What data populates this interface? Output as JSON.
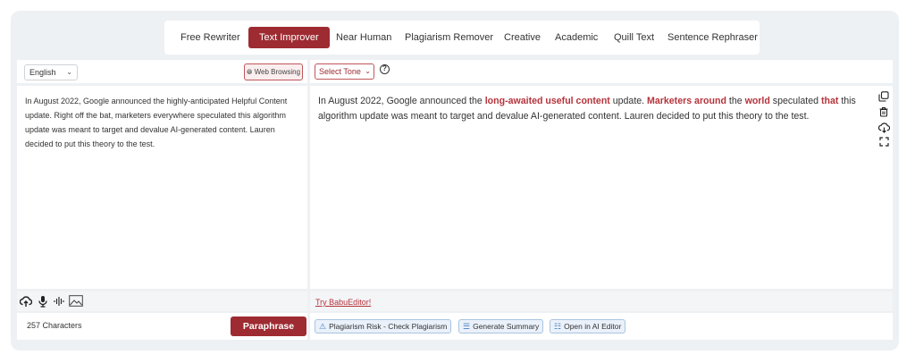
{
  "tabs": [
    {
      "label": "Free Rewriter",
      "active": false
    },
    {
      "label": "Text Improver",
      "active": true
    },
    {
      "label": "Near Human",
      "active": false
    },
    {
      "label": "Plagiarism Remover",
      "active": false
    },
    {
      "label": "Creative",
      "active": false
    },
    {
      "label": "Academic",
      "active": false
    },
    {
      "label": "Quill Text",
      "active": false
    },
    {
      "label": "Sentence Rephraser",
      "active": false
    }
  ],
  "input_panel": {
    "language": "English",
    "web_browsing_label": "Web Browsing",
    "text": "In August 2022, Google announced the highly-anticipated Helpful Content update. Right off the bat, marketers everywhere speculated this algorithm update was meant to target and devalue AI-generated content. Lauren decided to put this theory to the test.",
    "tools": [
      {
        "icon": "cloud-upload-icon"
      },
      {
        "icon": "microphone-icon"
      },
      {
        "icon": "audio-wave-icon"
      },
      {
        "icon": "image-icon"
      }
    ],
    "char_count": "257 Characters",
    "paraphrase_label": "Paraphrase"
  },
  "output_panel": {
    "tone_placeholder": "Select Tone",
    "segments": [
      {
        "text": "In August 2022, Google announced the ",
        "highlight": false
      },
      {
        "text": "long-awaited useful content",
        "highlight": true
      },
      {
        "text": " update. ",
        "highlight": false
      },
      {
        "text": "Marketers around",
        "highlight": true
      },
      {
        "text": " the ",
        "highlight": false
      },
      {
        "text": "world",
        "highlight": true
      },
      {
        "text": " speculated ",
        "highlight": false
      },
      {
        "text": "that",
        "highlight": true
      },
      {
        "text": " this algorithm update was meant to target and devalue AI-generated content. Lauren decided to put this theory to the test.",
        "highlight": false
      }
    ],
    "side_icons": [
      "copy-icon",
      "trash-icon",
      "cloud-download-icon",
      "fullscreen-icon"
    ],
    "try_link": "Try BabuEditor!",
    "chips": [
      {
        "label": "Plagiarism Risk - Check Plagiarism",
        "icon": "warning-icon"
      },
      {
        "label": "Generate Summary",
        "icon": "summary-icon"
      },
      {
        "label": "Open in AI Editor",
        "icon": "editor-icon"
      }
    ]
  },
  "colors": {
    "accent": "#9e2b32",
    "highlight_text": "#b5333b",
    "background": "#eef1f4",
    "chip_border": "#aac4e0"
  }
}
